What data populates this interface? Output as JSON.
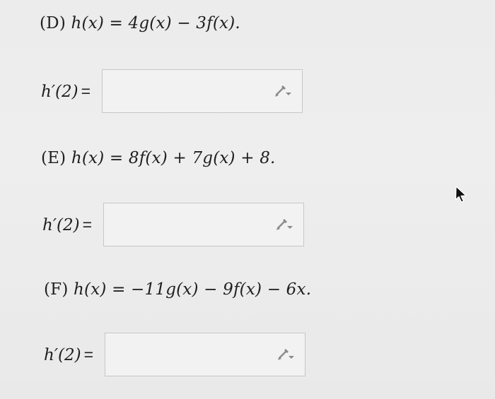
{
  "problems": [
    {
      "tag": "(D)",
      "expression": "h(x) = 4g(x) − 3f(x).",
      "answer_label": "h′(2)",
      "equals": "=",
      "answer_value": ""
    },
    {
      "tag": "(E)",
      "expression": "h(x) = 8f(x) + 7g(x) + 8.",
      "answer_label": "h′(2)",
      "equals": "=",
      "answer_value": ""
    },
    {
      "tag": "(F)",
      "expression": "h(x) = −11g(x) − 9f(x) − 6x.",
      "answer_label": "h′(2)",
      "equals": "=",
      "answer_value": ""
    }
  ],
  "icons": {
    "edit": "pencil-icon",
    "cursor": "mouse-cursor-icon"
  },
  "colors": {
    "background": "#ececec",
    "text": "#1f1f1f",
    "input_border": "#c7c7c7",
    "icon": "#8a8a8a"
  }
}
